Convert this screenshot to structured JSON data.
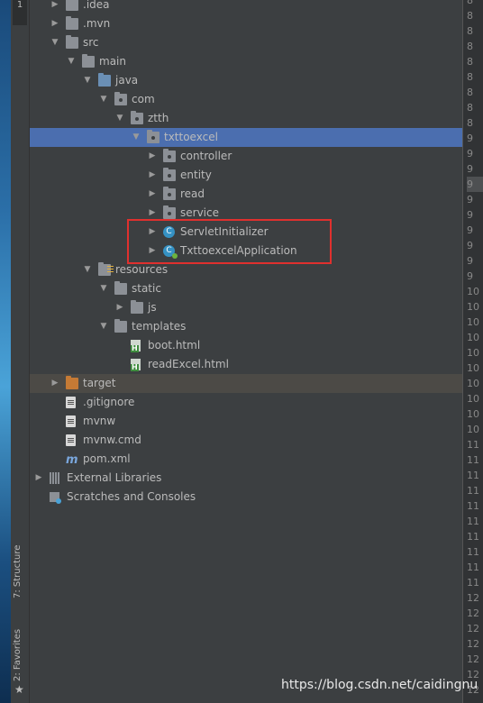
{
  "tool_window_tabs": {
    "project_tab": "1",
    "structure_tab": "7: Structure",
    "favorites_tab": "2: Favorites"
  },
  "tree": [
    {
      "label": ".idea",
      "depth": 1,
      "expanded": false,
      "icon": "folder-icon"
    },
    {
      "label": ".mvn",
      "depth": 1,
      "expanded": false,
      "icon": "folder-icon"
    },
    {
      "label": "src",
      "depth": 1,
      "expanded": true,
      "icon": "folder-icon"
    },
    {
      "label": "main",
      "depth": 2,
      "expanded": true,
      "icon": "folder-icon"
    },
    {
      "label": "java",
      "depth": 3,
      "expanded": true,
      "icon": "source-folder-icon"
    },
    {
      "label": "com",
      "depth": 4,
      "expanded": true,
      "icon": "package-icon"
    },
    {
      "label": "ztth",
      "depth": 5,
      "expanded": true,
      "icon": "package-icon"
    },
    {
      "label": "txttoexcel",
      "depth": 6,
      "expanded": true,
      "icon": "package-icon",
      "selected": true
    },
    {
      "label": "controller",
      "depth": 7,
      "expanded": false,
      "icon": "package-icon"
    },
    {
      "label": "entity",
      "depth": 7,
      "expanded": false,
      "icon": "package-icon"
    },
    {
      "label": "read",
      "depth": 7,
      "expanded": false,
      "icon": "package-icon"
    },
    {
      "label": "service",
      "depth": 7,
      "expanded": false,
      "icon": "package-icon"
    },
    {
      "label": "ServletInitializer",
      "depth": 7,
      "expanded": false,
      "icon": "class-icon"
    },
    {
      "label": "TxttoexcelApplication",
      "depth": 7,
      "expanded": false,
      "icon": "spring-boot-class-icon"
    },
    {
      "label": "resources",
      "depth": 3,
      "expanded": true,
      "icon": "resources-folder-icon"
    },
    {
      "label": "static",
      "depth": 4,
      "expanded": true,
      "icon": "folder-icon"
    },
    {
      "label": "js",
      "depth": 5,
      "expanded": false,
      "icon": "folder-icon"
    },
    {
      "label": "templates",
      "depth": 4,
      "expanded": true,
      "icon": "folder-icon"
    },
    {
      "label": "boot.html",
      "depth": 5,
      "icon": "html-file-icon"
    },
    {
      "label": "readExcel.html",
      "depth": 5,
      "icon": "html-file-icon"
    },
    {
      "label": "target",
      "depth": 1,
      "expanded": false,
      "icon": "excluded-folder-icon",
      "excluded": true
    },
    {
      "label": ".gitignore",
      "depth": 1,
      "icon": "text-file-icon"
    },
    {
      "label": "mvnw",
      "depth": 1,
      "icon": "text-file-icon"
    },
    {
      "label": "mvnw.cmd",
      "depth": 1,
      "icon": "text-file-icon"
    },
    {
      "label": "pom.xml",
      "depth": 1,
      "icon": "maven-icon"
    },
    {
      "label": "External Libraries",
      "depth": 0,
      "expanded": false,
      "icon": "libraries-icon"
    },
    {
      "label": "Scratches and Consoles",
      "depth": 0,
      "icon": "scratches-icon"
    }
  ],
  "gutter_lines": [
    "8",
    "8",
    "8",
    "8",
    "8",
    "8",
    "8",
    "8",
    "8",
    "9",
    "9",
    "9",
    "9",
    "9",
    "9",
    "9",
    "9",
    "9",
    "9",
    "10",
    "10",
    "10",
    "10",
    "10",
    "10",
    "10",
    "10",
    "10",
    "10",
    "11",
    "11",
    "11",
    "11",
    "11",
    "11",
    "11",
    "11",
    "11",
    "11",
    "12",
    "12",
    "12",
    "12",
    "12",
    "12",
    "12"
  ],
  "gutter_highlight_index": 12,
  "colors": {
    "panel_bg": "#3c3f41",
    "selection": "#4b6eaf",
    "highlight_box": "#e0302e",
    "text": "#bbbbbb"
  },
  "watermark": "https://blog.csdn.net/caidingnu"
}
